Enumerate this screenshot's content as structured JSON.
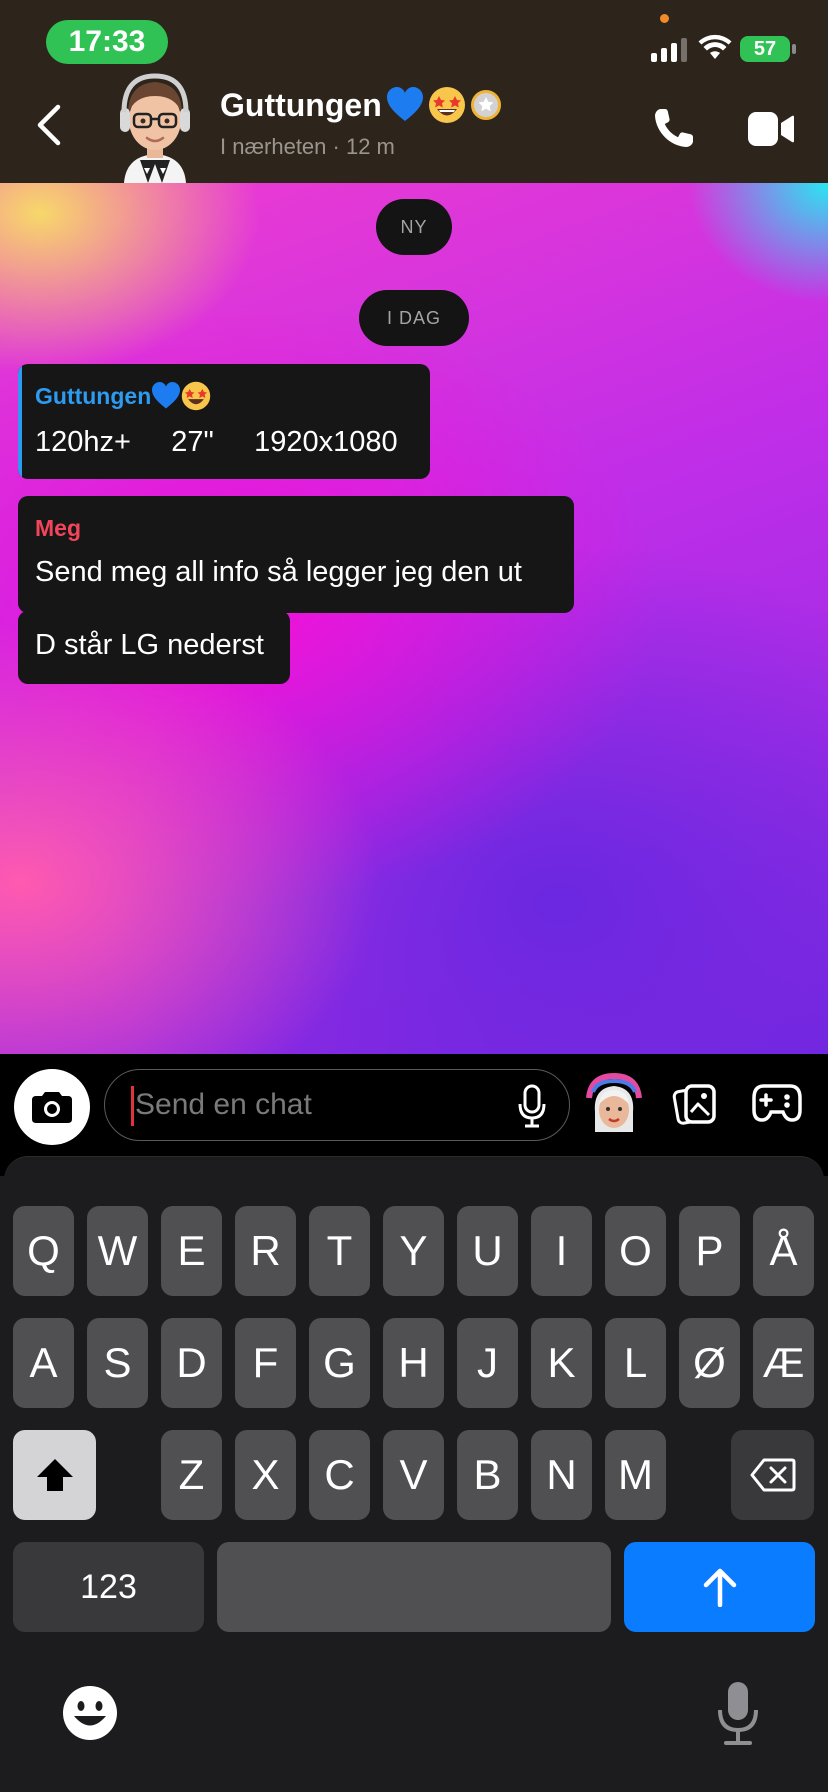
{
  "status_bar": {
    "time": "17:33",
    "battery": "57"
  },
  "header": {
    "contact_name": "Guttungen",
    "contact_status": "I nærheten · 12 m"
  },
  "chat": {
    "separator_new": "NY",
    "separator_day": "I DAG",
    "messages": [
      {
        "sender": "Guttungen",
        "text": "120hz+     27\"     1920x1080"
      },
      {
        "sender": "Meg",
        "text": "Send meg all info så legger jeg den ut"
      },
      {
        "text": "D står LG nederst"
      }
    ]
  },
  "composer": {
    "placeholder": "Send en chat"
  },
  "keyboard": {
    "row1": [
      "Q",
      "W",
      "E",
      "R",
      "T",
      "Y",
      "U",
      "I",
      "O",
      "P",
      "Å"
    ],
    "row2": [
      "A",
      "S",
      "D",
      "F",
      "G",
      "H",
      "J",
      "K",
      "L",
      "Ø",
      "Æ"
    ],
    "row3": [
      "Z",
      "X",
      "C",
      "V",
      "B",
      "N",
      "M"
    ],
    "numbers_key": "123"
  },
  "colors": {
    "accent_blue": "#2d9bf0",
    "me_red": "#f2455b",
    "time_green": "#30c254",
    "send_blue": "#0a7cff"
  },
  "icons": [
    "back-arrow-icon",
    "phone-icon",
    "video-call-icon",
    "camera-icon",
    "microphone-icon",
    "gallery-icon",
    "game-controller-icon",
    "shift-icon",
    "backspace-icon",
    "send-arrow-icon",
    "emoji-icon",
    "dictation-icon"
  ]
}
